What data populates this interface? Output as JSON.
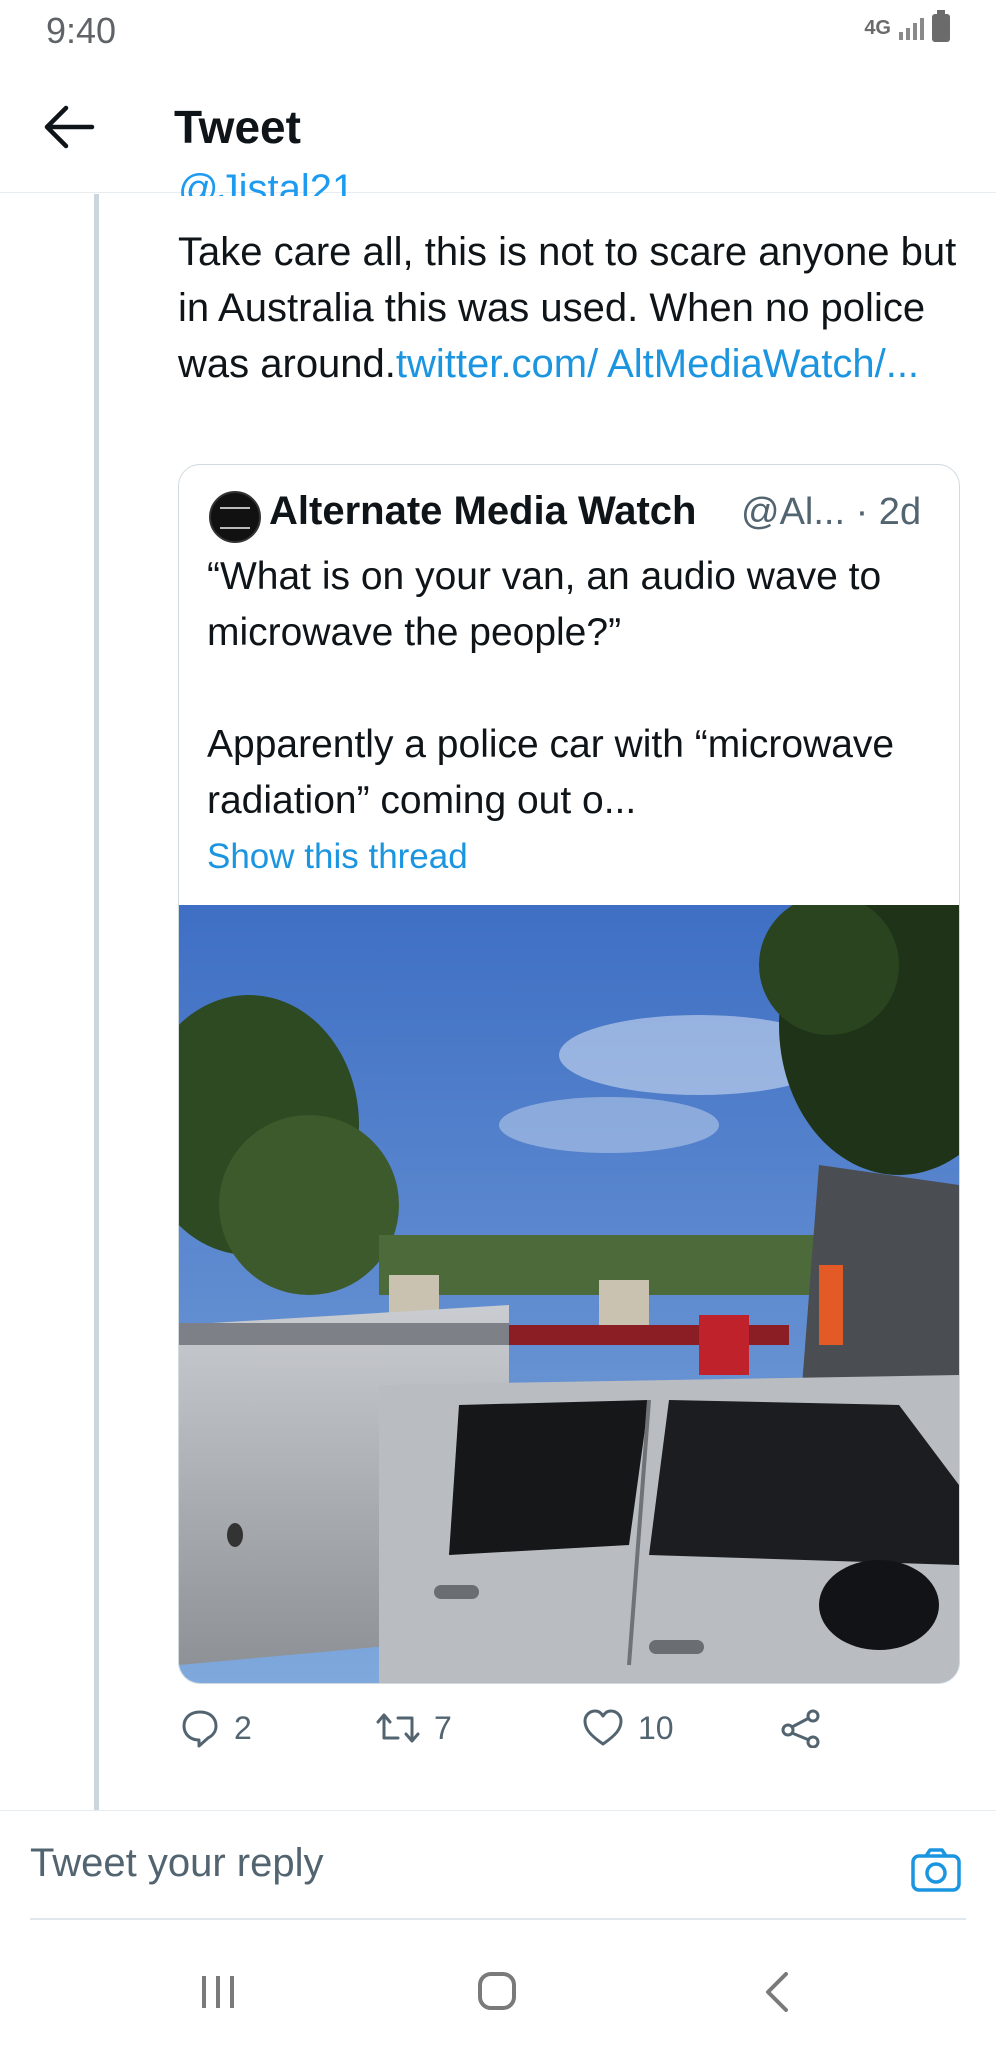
{
  "status_bar": {
    "time": "9:40",
    "network": "4G"
  },
  "header": {
    "title": "Tweet"
  },
  "tweet": {
    "handle_partial": "@Jistal21",
    "text": "Take care all, this is not to scare anyone but in Australia this was used. When no police was around.",
    "link_text": "twitter.com/ AltMediaWatch/..."
  },
  "quote": {
    "name": "Alternate Media Watch",
    "handle": "@Al... · 2d",
    "text_line1": "“What is on your van, an audio wave to microwave the people?”",
    "text_line2": "Apparently a police car with “microwave radiation” coming out o...",
    "show_thread": "Show this thread"
  },
  "actions": {
    "replies": "2",
    "retweets": "7",
    "likes": "10"
  },
  "reply": {
    "placeholder": "Tweet your reply"
  },
  "colors": {
    "accent": "#1b95e0",
    "muted": "#536471",
    "border": "#cfd9de"
  }
}
